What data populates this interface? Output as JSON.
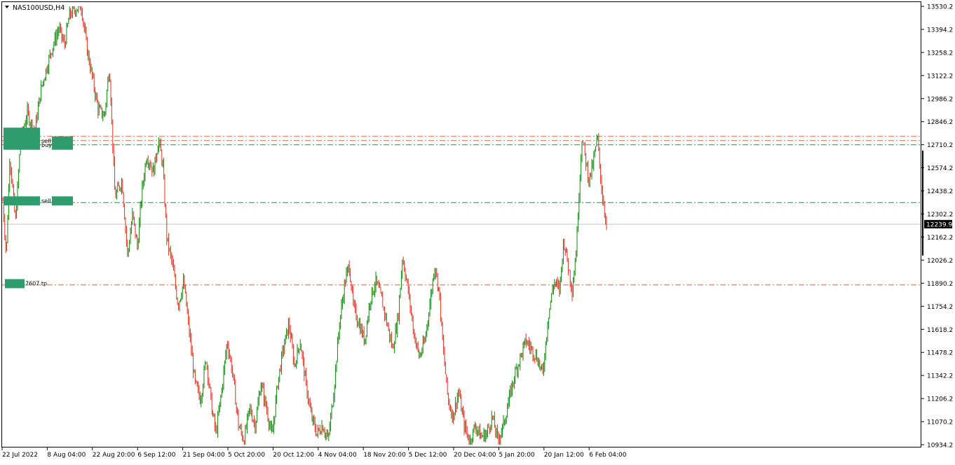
{
  "window": {
    "title": "NAS100USD,H4",
    "menu_icon": "triangle-down-icon"
  },
  "chart_data": {
    "type": "candlestick",
    "symbol": "NAS100USD",
    "timeframe": "H4",
    "ylim": [
      10934.2,
      13530.2
    ],
    "y_ticks": [
      "13530.2",
      "13394.2",
      "13258.2",
      "13122.2",
      "12986.2",
      "12846.2",
      "12710.2",
      "12574.2",
      "12438.2",
      "12302.2",
      "12162.2",
      "12026.2",
      "11890.2",
      "11754.2",
      "11618.2",
      "11478.2",
      "11342.2",
      "11206.2",
      "11070.2",
      "10934.2"
    ],
    "x_ticks": [
      "22 Jul 2022",
      "8 Aug 04:00",
      "22 Aug 20:00",
      "6 Sep 12:00",
      "21 Sep 04:00",
      "5 Oct 20:00",
      "20 Oct 12:00",
      "4 Nov 04:00",
      "18 Nov 20:00",
      "5 Dec 12:00",
      "20 Dec 04:00",
      "5 Jan 20:00",
      "20 Jan 12:00",
      "6 Feb 04:00"
    ],
    "current_price": "12239.9",
    "colors": {
      "bull": "#0a8a0a",
      "bear": "#e0301e",
      "level_sell": "#e06a3a",
      "level_buy": "#2e8b57",
      "grid_current": "#c8c8c8",
      "price_tag_bg": "#000000",
      "price_tag_fg": "#ffffff",
      "marker_box": "#2e9c6c"
    },
    "levels": [
      {
        "price": 12760,
        "style": "sell"
      },
      {
        "price": 12735,
        "style": "sell"
      },
      {
        "price": 12710,
        "style": "buy"
      },
      {
        "price": 12368,
        "style": "buy"
      },
      {
        "price": 11880,
        "style": "sell"
      }
    ],
    "markers": [
      {
        "price": 12735,
        "label": "sell"
      },
      {
        "price": 12710,
        "label": "buy"
      },
      {
        "price": 12380,
        "label": "sell"
      },
      {
        "price": 11890,
        "label": "7607 tp"
      }
    ],
    "path": [
      [
        0,
        12380
      ],
      [
        5,
        12050
      ],
      [
        10,
        12650
      ],
      [
        18,
        12250
      ],
      [
        25,
        12720
      ],
      [
        35,
        12900
      ],
      [
        45,
        12780
      ],
      [
        55,
        13050
      ],
      [
        70,
        13280
      ],
      [
        80,
        13400
      ],
      [
        88,
        13300
      ],
      [
        95,
        13480
      ],
      [
        105,
        13520
      ],
      [
        112,
        13530
      ],
      [
        120,
        13280
      ],
      [
        128,
        13100
      ],
      [
        136,
        12920
      ],
      [
        145,
        12880
      ],
      [
        152,
        13180
      ],
      [
        160,
        12400
      ],
      [
        170,
        12500
      ],
      [
        178,
        12050
      ],
      [
        185,
        12300
      ],
      [
        192,
        12100
      ],
      [
        198,
        12420
      ],
      [
        205,
        12650
      ],
      [
        215,
        12550
      ],
      [
        222,
        12740
      ],
      [
        228,
        12600
      ],
      [
        234,
        12150
      ],
      [
        242,
        12000
      ],
      [
        250,
        11760
      ],
      [
        258,
        11900
      ],
      [
        266,
        11600
      ],
      [
        274,
        11300
      ],
      [
        282,
        11200
      ],
      [
        290,
        11450
      ],
      [
        298,
        11150
      ],
      [
        304,
        11000
      ],
      [
        312,
        11250
      ],
      [
        320,
        11550
      ],
      [
        328,
        11350
      ],
      [
        336,
        11050
      ],
      [
        344,
        10960
      ],
      [
        352,
        11150
      ],
      [
        360,
        11050
      ],
      [
        368,
        11300
      ],
      [
        376,
        11150
      ],
      [
        384,
        10980
      ],
      [
        392,
        11300
      ],
      [
        400,
        11500
      ],
      [
        408,
        11650
      ],
      [
        416,
        11400
      ],
      [
        424,
        11550
      ],
      [
        432,
        11300
      ],
      [
        440,
        11100
      ],
      [
        448,
        11000
      ],
      [
        456,
        11050
      ],
      [
        464,
        10960
      ],
      [
        472,
        11250
      ],
      [
        480,
        11650
      ],
      [
        488,
        11900
      ],
      [
        494,
        12000
      ],
      [
        500,
        11750
      ],
      [
        508,
        11650
      ],
      [
        516,
        11550
      ],
      [
        524,
        11800
      ],
      [
        532,
        11900
      ],
      [
        540,
        11800
      ],
      [
        548,
        11650
      ],
      [
        556,
        11500
      ],
      [
        564,
        11700
      ],
      [
        570,
        12050
      ],
      [
        578,
        11850
      ],
      [
        586,
        11600
      ],
      [
        594,
        11450
      ],
      [
        602,
        11550
      ],
      [
        610,
        11800
      ],
      [
        616,
        12000
      ],
      [
        622,
        11850
      ],
      [
        628,
        11500
      ],
      [
        635,
        11200
      ],
      [
        642,
        11100
      ],
      [
        650,
        11250
      ],
      [
        658,
        11050
      ],
      [
        666,
        10950
      ],
      [
        674,
        11050
      ],
      [
        682,
        10980
      ],
      [
        690,
        11000
      ],
      [
        698,
        11100
      ],
      [
        706,
        10960
      ],
      [
        714,
        11050
      ],
      [
        722,
        11200
      ],
      [
        730,
        11350
      ],
      [
        738,
        11450
      ],
      [
        746,
        11550
      ],
      [
        754,
        11500
      ],
      [
        762,
        11450
      ],
      [
        770,
        11350
      ],
      [
        778,
        11700
      ],
      [
        786,
        11900
      ],
      [
        794,
        11850
      ],
      [
        800,
        12150
      ],
      [
        806,
        12000
      ],
      [
        812,
        11850
      ],
      [
        818,
        12100
      ],
      [
        822,
        12450
      ],
      [
        826,
        12750
      ],
      [
        830,
        12650
      ],
      [
        836,
        12500
      ],
      [
        842,
        12600
      ],
      [
        848,
        12760
      ],
      [
        854,
        12450
      ],
      [
        858,
        12320
      ],
      [
        862,
        12239
      ]
    ]
  }
}
